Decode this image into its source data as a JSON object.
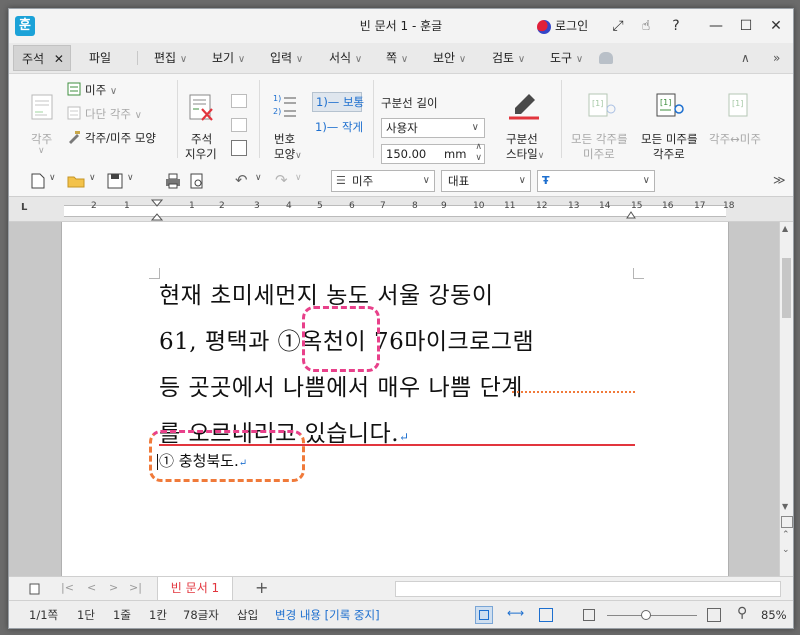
{
  "window": {
    "title": "빈 문서 1 - 훈글",
    "app_icon": "훈",
    "login_label": "로그인",
    "controls": {
      "expand": "⤢",
      "hand": "☝",
      "help": "?",
      "minimize": "—",
      "maximize": "☐",
      "close": "✕"
    }
  },
  "menu": {
    "active_tab": "주석",
    "active_tab_close": "✕",
    "items": [
      "파일",
      "편집",
      "보기",
      "입력",
      "서식",
      "쪽",
      "보안",
      "검토",
      "도구"
    ],
    "caret": "∨",
    "collapse": "∧",
    "more": "»"
  },
  "ribbon": {
    "footnote": "각주",
    "endnote": "미주",
    "multi_footnote": "다단 각주",
    "note_shape": "각주/미주 모양",
    "delete_note_line1": "주석",
    "delete_note_line2": "지우기",
    "number_shape_line1": "번호",
    "number_shape_line2": "모양",
    "normal": "1)— 보통",
    "small": "1)— 작게",
    "separator_length": "구분선 길이",
    "separator_select": "사용자",
    "separator_value": "150.00",
    "separator_unit": "mm",
    "separator_style_line1": "구분선",
    "separator_style_line2": "스타일",
    "all_foot_to_end_line1": "모든 각주를",
    "all_foot_to_end_line2": "미주로",
    "all_end_to_foot_line1": "모든 미주를",
    "all_end_to_foot_line2": "각주로",
    "swap": "각주↔미주"
  },
  "toolbar": {
    "style_select": "미주",
    "font_select": "대표",
    "font_name_select": ""
  },
  "ruler": {
    "numbers": [
      "2",
      "1",
      "1",
      "2",
      "3",
      "4",
      "5",
      "6",
      "7",
      "8",
      "9",
      "10",
      "11",
      "12",
      "13",
      "14",
      "15",
      "16",
      "17",
      "18"
    ],
    "corner": "L"
  },
  "document": {
    "lines": [
      "현재  초미세먼지  농도  서울  강동이",
      "61,  평택과  ①옥천이  76마이크로그램",
      "등  곳곳에서  나쁨에서  매우  나쁨  단계",
      "를  오르내리고  있습니다."
    ],
    "return_mark": "↵",
    "endnote_text": "①  충청북도."
  },
  "tabs": {
    "doc_tab": "빈 문서 1",
    "add_tab": "+"
  },
  "status": {
    "page": "1/1쪽",
    "column": "1단",
    "line": "1줄",
    "col": "1칸",
    "chars": "78글자",
    "mode": "삽입",
    "track": "변경 내용 [기록 중지]",
    "zoom": "85%"
  },
  "colors": {
    "accent_red": "#e2353d",
    "annotation_pink": "#e8408a",
    "annotation_orange": "#f07a3a",
    "blue_link": "#1d6fcf"
  }
}
